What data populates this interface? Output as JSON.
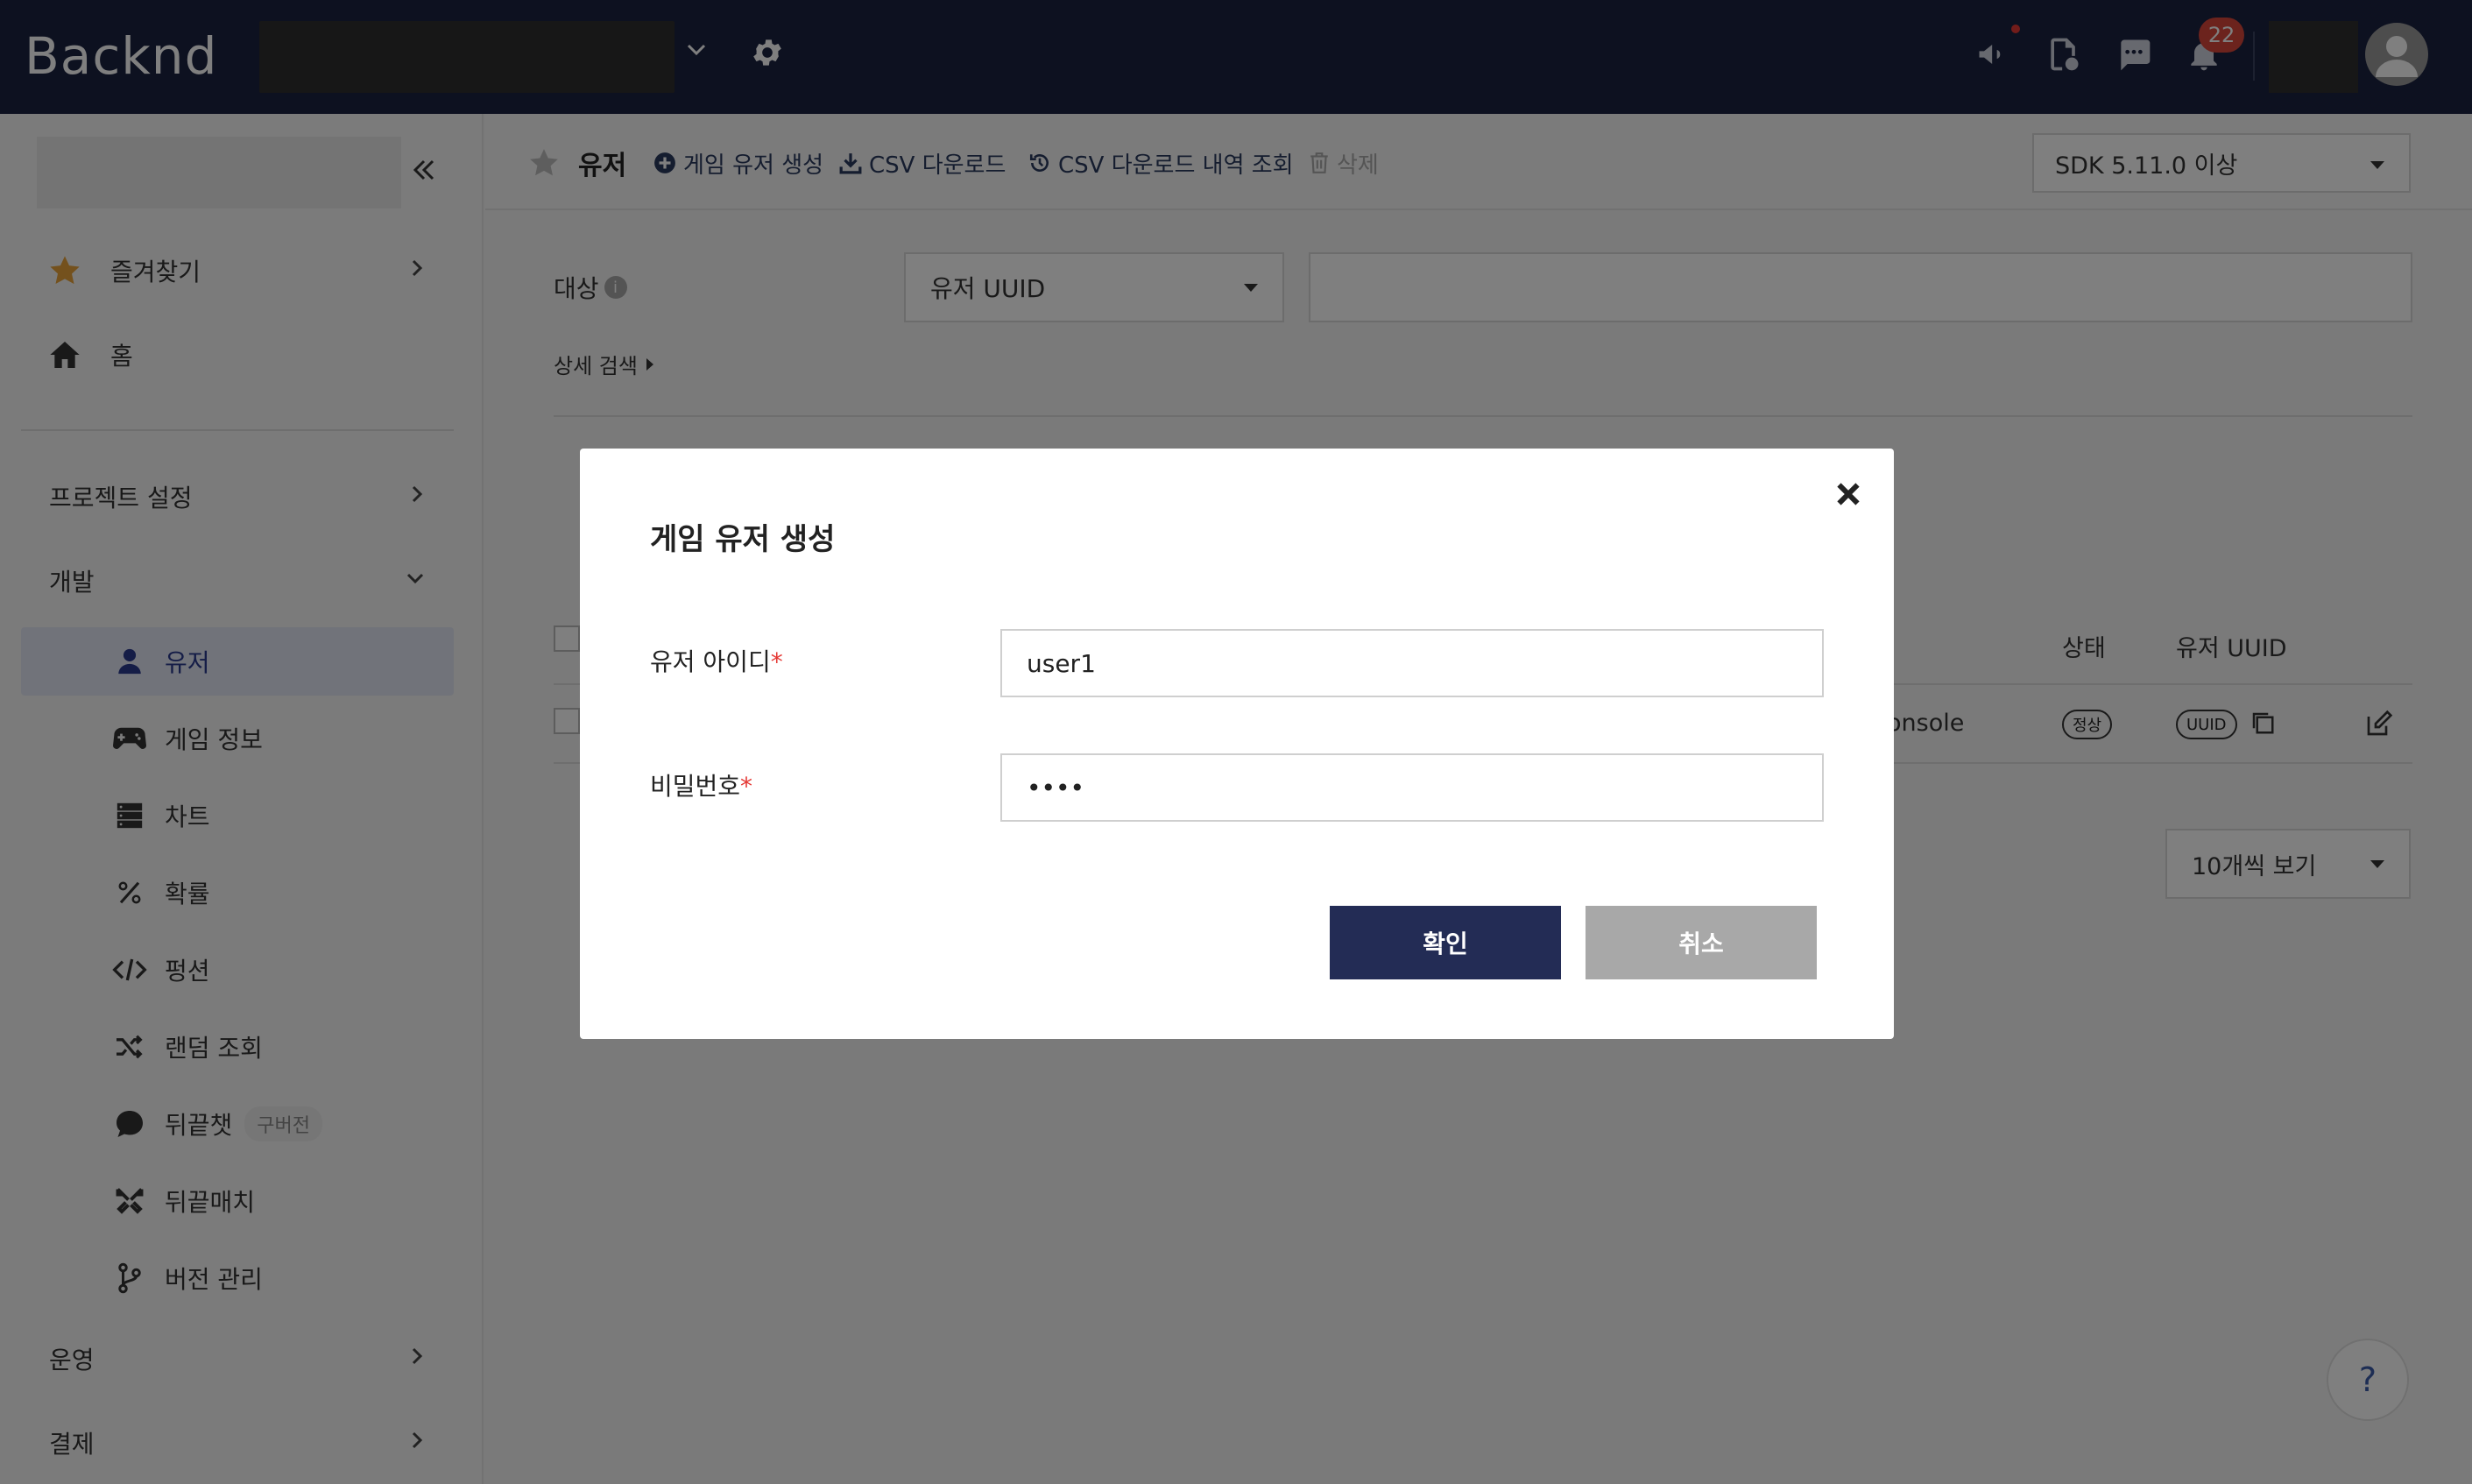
{
  "app": {
    "logo": "Backnd"
  },
  "topbar": {
    "notification_count": "22"
  },
  "sidebar": {
    "favorites": "즐겨찾기",
    "home": "홈",
    "project_settings": "프로젝트 설정",
    "development": "개발",
    "dev_items": [
      "유저",
      "게임 정보",
      "차트",
      "확률",
      "펑션",
      "랜덤 조회",
      "뒤끝챗",
      "뒤끝매치",
      "버전 관리"
    ],
    "legacy_tag": "구버전",
    "operations": "운영",
    "payment": "결제"
  },
  "toolbar": {
    "title": "유저",
    "create_user": "게임 유저 생성",
    "csv_download": "CSV 다운로드",
    "csv_history": "CSV 다운로드 내역 조회",
    "delete": "삭제",
    "sdk_version": "SDK 5.11.0 이상"
  },
  "filter": {
    "target_label": "대상",
    "target_value": "유저 UUID",
    "detail_search": "상세 검색"
  },
  "table": {
    "headers": {
      "status": "상태",
      "uuid": "유저 UUID"
    },
    "row": {
      "partial_text": "onsole",
      "status": "정상",
      "uuid": "UUID"
    }
  },
  "pagination": {
    "page_size": "10개씩 보기"
  },
  "help": "?",
  "modal": {
    "title": "게임 유저 생성",
    "user_id_label": "유저 아이디",
    "user_id_value": "user1",
    "password_label": "비밀번호",
    "password_value": "••••",
    "required_mark": "*",
    "confirm": "확인",
    "cancel": "취소"
  },
  "colors": {
    "topbar": "#1a2240",
    "accent": "#232c55",
    "badge": "#d9463b",
    "star": "#e8a33a"
  }
}
